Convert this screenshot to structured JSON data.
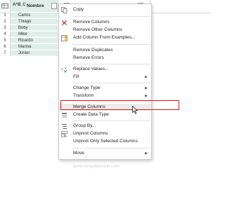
{
  "table": {
    "column_name": "Nombre",
    "column_type_icon": "A^B_C",
    "rows": [
      {
        "num": "1",
        "value": "Carlos"
      },
      {
        "num": "2",
        "value": "Thiago"
      },
      {
        "num": "3",
        "value": "Boby"
      },
      {
        "num": "4",
        "value": "Mike"
      },
      {
        "num": "5",
        "value": "Ricardo"
      },
      {
        "num": "6",
        "value": "Marina"
      },
      {
        "num": "7",
        "value": "Júnior"
      }
    ]
  },
  "context_menu": {
    "items": [
      {
        "label": "Copy",
        "icon": "copy-icon",
        "has_submenu": false
      },
      {
        "label": "Remove Columns",
        "icon": "remove-columns-icon",
        "has_submenu": false
      },
      {
        "label": "Remove Other Columns",
        "icon": "",
        "has_submenu": false
      },
      {
        "label": "Add Column From Examples...",
        "icon": "add-column-examples-icon",
        "has_submenu": false
      },
      {
        "label": "Remove Duplicates",
        "icon": "",
        "has_submenu": false
      },
      {
        "label": "Remove Errors",
        "icon": "",
        "has_submenu": false
      },
      {
        "label": "Replace Values...",
        "icon": "replace-values-icon",
        "has_submenu": false
      },
      {
        "label": "Fill",
        "icon": "",
        "has_submenu": true
      },
      {
        "label": "Change Type",
        "icon": "",
        "has_submenu": true
      },
      {
        "label": "Transform",
        "icon": "",
        "has_submenu": true
      },
      {
        "label": "Merge Columns",
        "icon": "",
        "has_submenu": false
      },
      {
        "label": "Create Data Type",
        "icon": "create-data-type-icon",
        "has_submenu": false
      },
      {
        "label": "Group By...",
        "icon": "group-by-icon",
        "has_submenu": false
      },
      {
        "label": "Unpivot Columns",
        "icon": "unpivot-columns-icon",
        "has_submenu": false
      },
      {
        "label": "Unpivot Only Selected Columns",
        "icon": "",
        "has_submenu": false
      },
      {
        "label": "Move",
        "icon": "",
        "has_submenu": true
      }
    ],
    "highlighted_item": "Merge Columns",
    "highlight_color": "#e0161b"
  },
  "watermark": "www.ninjadelexcel.com"
}
